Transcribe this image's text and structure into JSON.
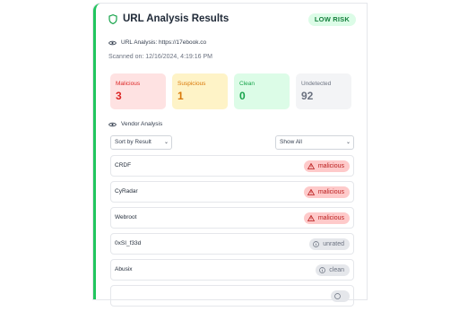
{
  "header": {
    "title": "URL Analysis Results",
    "risk_badge": "LOW RISK"
  },
  "scan": {
    "url_label": "URL Analysis: https://17ebook.co",
    "scanned": "Scanned on: 12/16/2024, 4:19:16 PM"
  },
  "stats": [
    {
      "label": "Malicious",
      "value": "3",
      "color": "#dc2626"
    },
    {
      "label": "Suspicious",
      "value": "1",
      "color": "#d97706"
    },
    {
      "label": "Clean",
      "value": "0",
      "color": "#16a34a"
    },
    {
      "label": "Undetected",
      "value": "92",
      "color": "#6b7280"
    }
  ],
  "vendor": {
    "heading": "Vendor Analysis",
    "sort_value": "Sort by Result",
    "filter_value": "Show All",
    "rows": [
      {
        "name": "CRDF",
        "result": "malicious",
        "icon": "warning-icon"
      },
      {
        "name": "CyRadar",
        "result": "malicious",
        "icon": "warning-icon"
      },
      {
        "name": "Webroot",
        "result": "malicious",
        "icon": "warning-icon"
      },
      {
        "name": "0xSI_f33d",
        "result": "unrated",
        "icon": "info-icon"
      },
      {
        "name": "Abusix",
        "result": "clean",
        "icon": "info-icon"
      },
      {
        "name": "",
        "result": "",
        "icon": "info-icon"
      }
    ]
  },
  "colors": {
    "accent": "#22c55e",
    "malicious": "#b91c1c",
    "neutral": "#6b7280"
  }
}
